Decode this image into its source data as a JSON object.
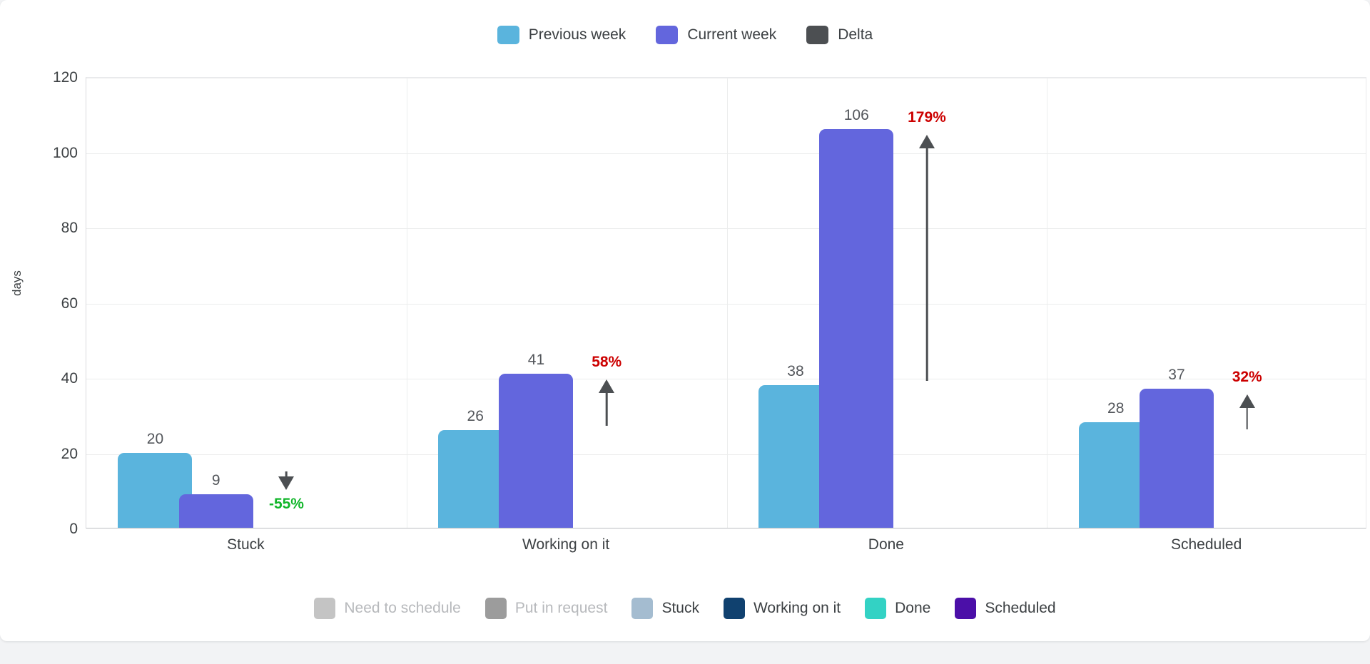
{
  "chart_data": {
    "type": "bar",
    "title": "",
    "subtitle": "",
    "xlabel": "",
    "ylabel": "days",
    "ylim": [
      0,
      120
    ],
    "yticks": [
      0,
      20,
      40,
      60,
      80,
      100,
      120
    ],
    "ytick_labels": [
      "0",
      "20",
      "40",
      "60",
      "80",
      "100",
      "120"
    ],
    "grid": true,
    "legend_position": "top",
    "categories": [
      "Stuck",
      "Working on it",
      "Done",
      "Scheduled"
    ],
    "series": [
      {
        "name": "Previous week",
        "color": "#5ab4dd",
        "values": [
          20,
          26,
          38,
          28
        ]
      },
      {
        "name": "Current week",
        "color": "#6366dd",
        "values": [
          9,
          41,
          106,
          37
        ]
      },
      {
        "name": "Delta",
        "color": "#4c4f52",
        "values": [
          -55,
          58,
          179,
          32
        ]
      }
    ],
    "value_labels": {
      "previous_week": [
        "20",
        "26",
        "38",
        "28"
      ],
      "current_week": [
        "9",
        "41",
        "106",
        "37"
      ]
    },
    "annotations": [
      {
        "category": "Stuck",
        "text": "-55%",
        "direction": "down",
        "color": "#12b62b"
      },
      {
        "category": "Working on it",
        "text": "58%",
        "direction": "up",
        "color": "#cc0000"
      },
      {
        "category": "Done",
        "text": "179%",
        "direction": "up",
        "color": "#cc0000"
      },
      {
        "category": "Scheduled",
        "text": "32%",
        "direction": "up",
        "color": "#cc0000"
      }
    ]
  },
  "top_legend": {
    "items": [
      {
        "label": "Previous week",
        "color": "#5ab4dd"
      },
      {
        "label": "Current week",
        "color": "#6366dd"
      },
      {
        "label": "Delta",
        "color": "#4c4f52"
      }
    ]
  },
  "bottom_legend": {
    "items": [
      {
        "label": "Need to schedule",
        "color": "#c4c4c4",
        "dimmed": true
      },
      {
        "label": "Put in request",
        "color": "#9c9c9c",
        "dimmed": true
      },
      {
        "label": "Stuck",
        "color": "#a4bcd0",
        "dimmed": false
      },
      {
        "label": "Working on it",
        "color": "#10416f",
        "dimmed": false
      },
      {
        "label": "Done",
        "color": "#33d2c4",
        "dimmed": false
      },
      {
        "label": "Scheduled",
        "color": "#4b0fa8",
        "dimmed": false
      }
    ]
  }
}
